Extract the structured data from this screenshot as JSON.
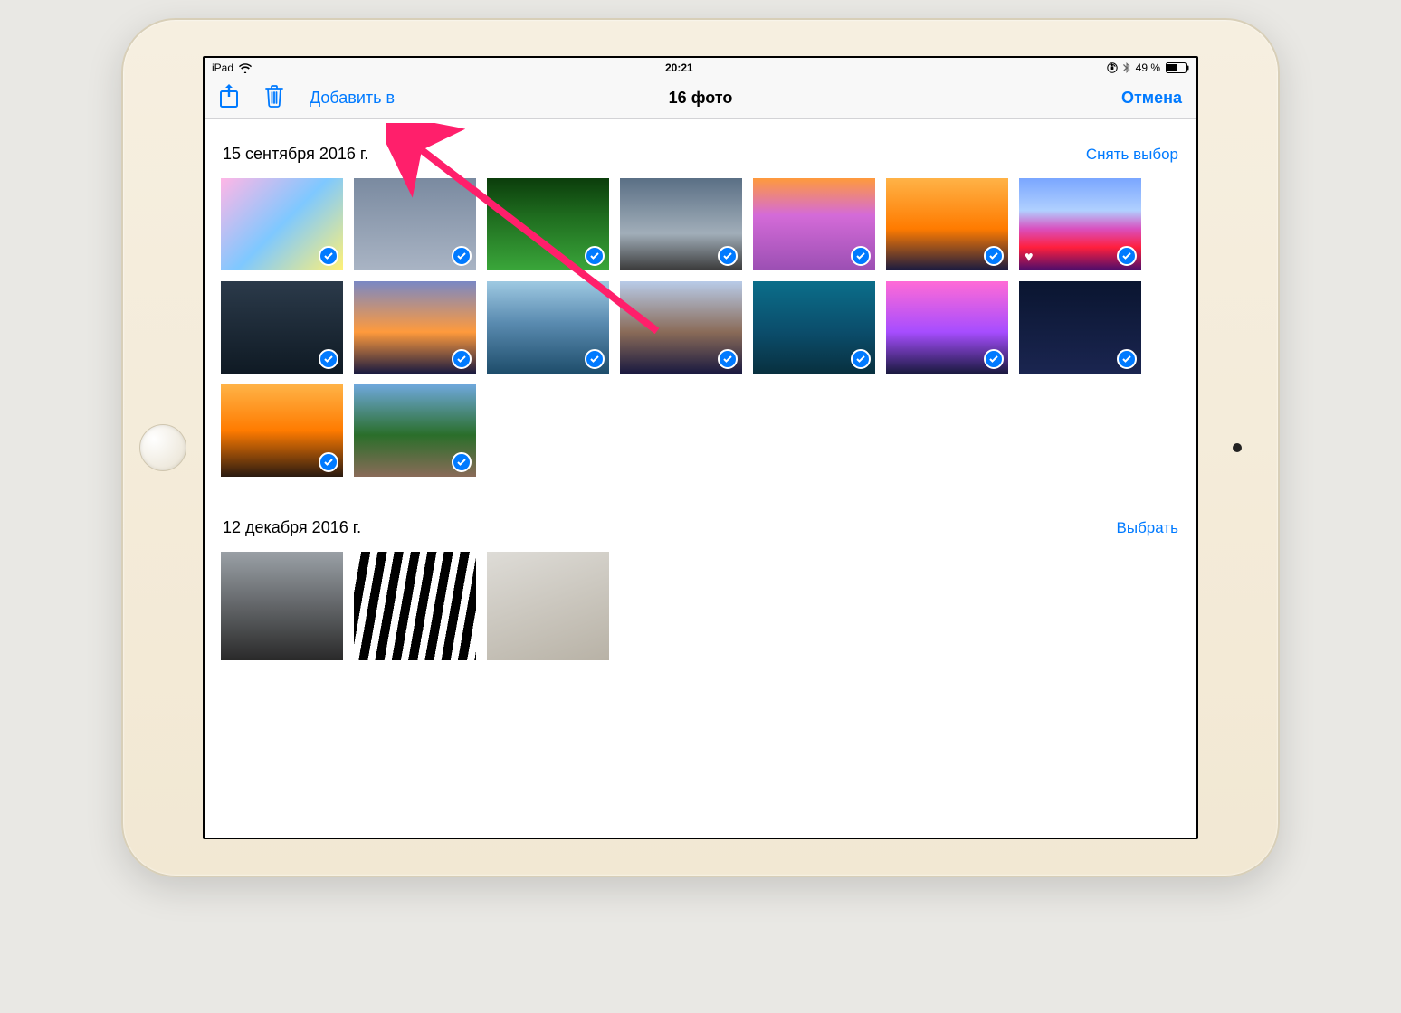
{
  "status": {
    "device": "iPad",
    "time": "20:21",
    "battery_text": "49 %"
  },
  "toolbar": {
    "add_to": "Добавить в",
    "title": "16 фото",
    "cancel": "Отмена"
  },
  "sections": [
    {
      "date": "15 сентября 2016 г.",
      "action": "Снять выбор",
      "photos": [
        {
          "selected": true,
          "favorite": false
        },
        {
          "selected": true,
          "favorite": false
        },
        {
          "selected": true,
          "favorite": false
        },
        {
          "selected": true,
          "favorite": false
        },
        {
          "selected": true,
          "favorite": false
        },
        {
          "selected": true,
          "favorite": false
        },
        {
          "selected": true,
          "favorite": true
        },
        {
          "selected": true,
          "favorite": false
        },
        {
          "selected": true,
          "favorite": false
        },
        {
          "selected": true,
          "favorite": false
        },
        {
          "selected": true,
          "favorite": false
        },
        {
          "selected": true,
          "favorite": false
        },
        {
          "selected": true,
          "favorite": false
        },
        {
          "selected": true,
          "favorite": false
        },
        {
          "selected": true,
          "favorite": false
        },
        {
          "selected": true,
          "favorite": false
        }
      ]
    },
    {
      "date": "12 декабря 2016 г.",
      "action": "Выбрать",
      "photos": [
        {
          "selected": false,
          "favorite": false
        },
        {
          "selected": false,
          "favorite": false
        },
        {
          "selected": false,
          "favorite": false
        }
      ]
    }
  ],
  "colors": {
    "accent": "#007aff"
  }
}
